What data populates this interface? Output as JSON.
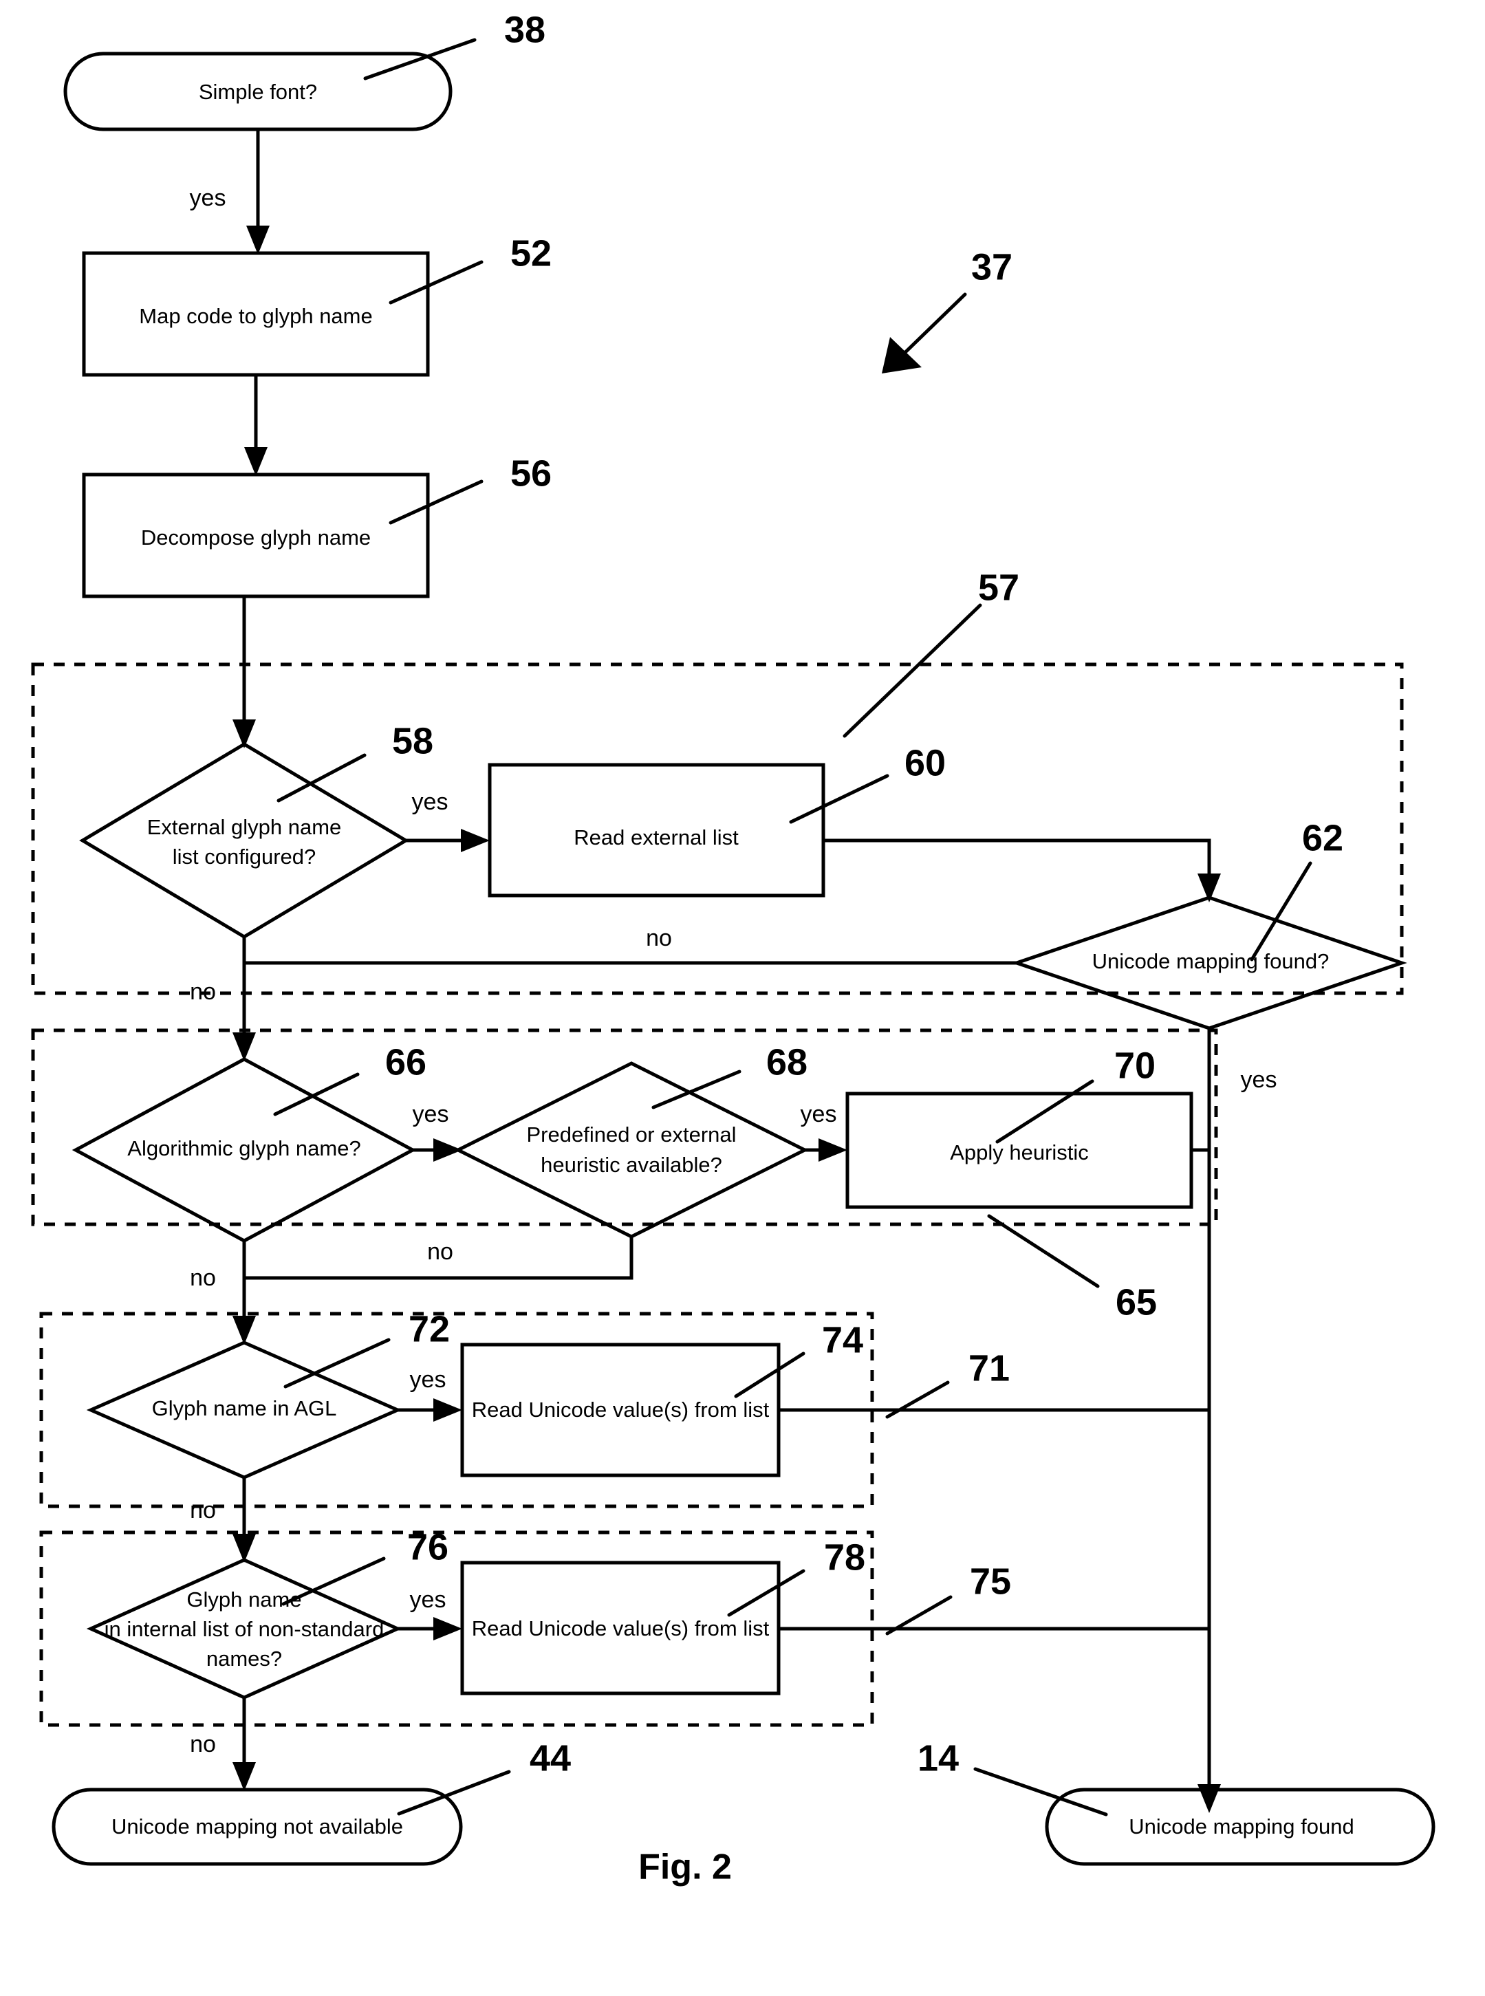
{
  "figure": {
    "caption": "Fig. 2",
    "overall_ref": "37"
  },
  "nodes": {
    "start": {
      "ref": "38",
      "label": "Simple font?",
      "shape": "stadium"
    },
    "map_code": {
      "ref": "52",
      "label": "Map code to glyph name",
      "shape": "rect"
    },
    "decompose": {
      "ref": "56",
      "label": "Decompose glyph name",
      "shape": "rect"
    },
    "ext_list_cfg": {
      "ref": "58",
      "label_line1": "External glyph name",
      "label_line2": "list configured?",
      "shape": "diamond"
    },
    "read_ext_list": {
      "ref": "60",
      "label": "Read external list",
      "shape": "rect"
    },
    "unicode_found_q": {
      "ref": "62",
      "label": "Unicode mapping found?",
      "shape": "diamond"
    },
    "algorithmic_q": {
      "ref": "66",
      "label": "Algorithmic glyph name?",
      "shape": "diamond"
    },
    "heuristic_q": {
      "ref": "68",
      "label_line1": "Predefined or external",
      "label_line2": "heuristic available?",
      "shape": "diamond"
    },
    "apply_heuristic": {
      "ref": "70",
      "label": "Apply  heuristic",
      "shape": "rect"
    },
    "agl_q": {
      "ref": "72",
      "label": "Glyph name in AGL",
      "shape": "diamond"
    },
    "read_unicode_agl": {
      "ref": "74",
      "label": "Read Unicode value(s) from list",
      "shape": "rect"
    },
    "nonstandard_q": {
      "ref": "76",
      "label_line1": "Glyph name",
      "label_line2": "in internal list of non-standard",
      "label_line3": "names?",
      "shape": "diamond"
    },
    "read_unicode_internal": {
      "ref": "78",
      "label": "Read Unicode value(s) from list",
      "shape": "rect"
    },
    "not_available": {
      "ref": "44",
      "label": "Unicode mapping not available",
      "shape": "stadium"
    },
    "found": {
      "ref": "14",
      "label": "Unicode mapping found",
      "shape": "stadium"
    }
  },
  "groups": {
    "external_list_stage": {
      "ref": "57"
    },
    "heuristic_stage": {
      "ref": "65"
    },
    "agl_stage": {
      "ref": "71"
    },
    "internal_list_stage": {
      "ref": "75"
    }
  },
  "edge_labels": {
    "start_yes": "yes",
    "ext_yes": "yes",
    "ext_no": "no",
    "found_no": "no",
    "found_yes": "yes",
    "algo_yes": "yes",
    "algo_no": "no",
    "heuristic_yes": "yes",
    "heuristic_no": "no",
    "agl_yes": "yes",
    "agl_no": "no",
    "nonstd_yes": "yes",
    "nonstd_no": "no"
  },
  "colors": {
    "stroke": "#000000",
    "background": "#ffffff"
  }
}
